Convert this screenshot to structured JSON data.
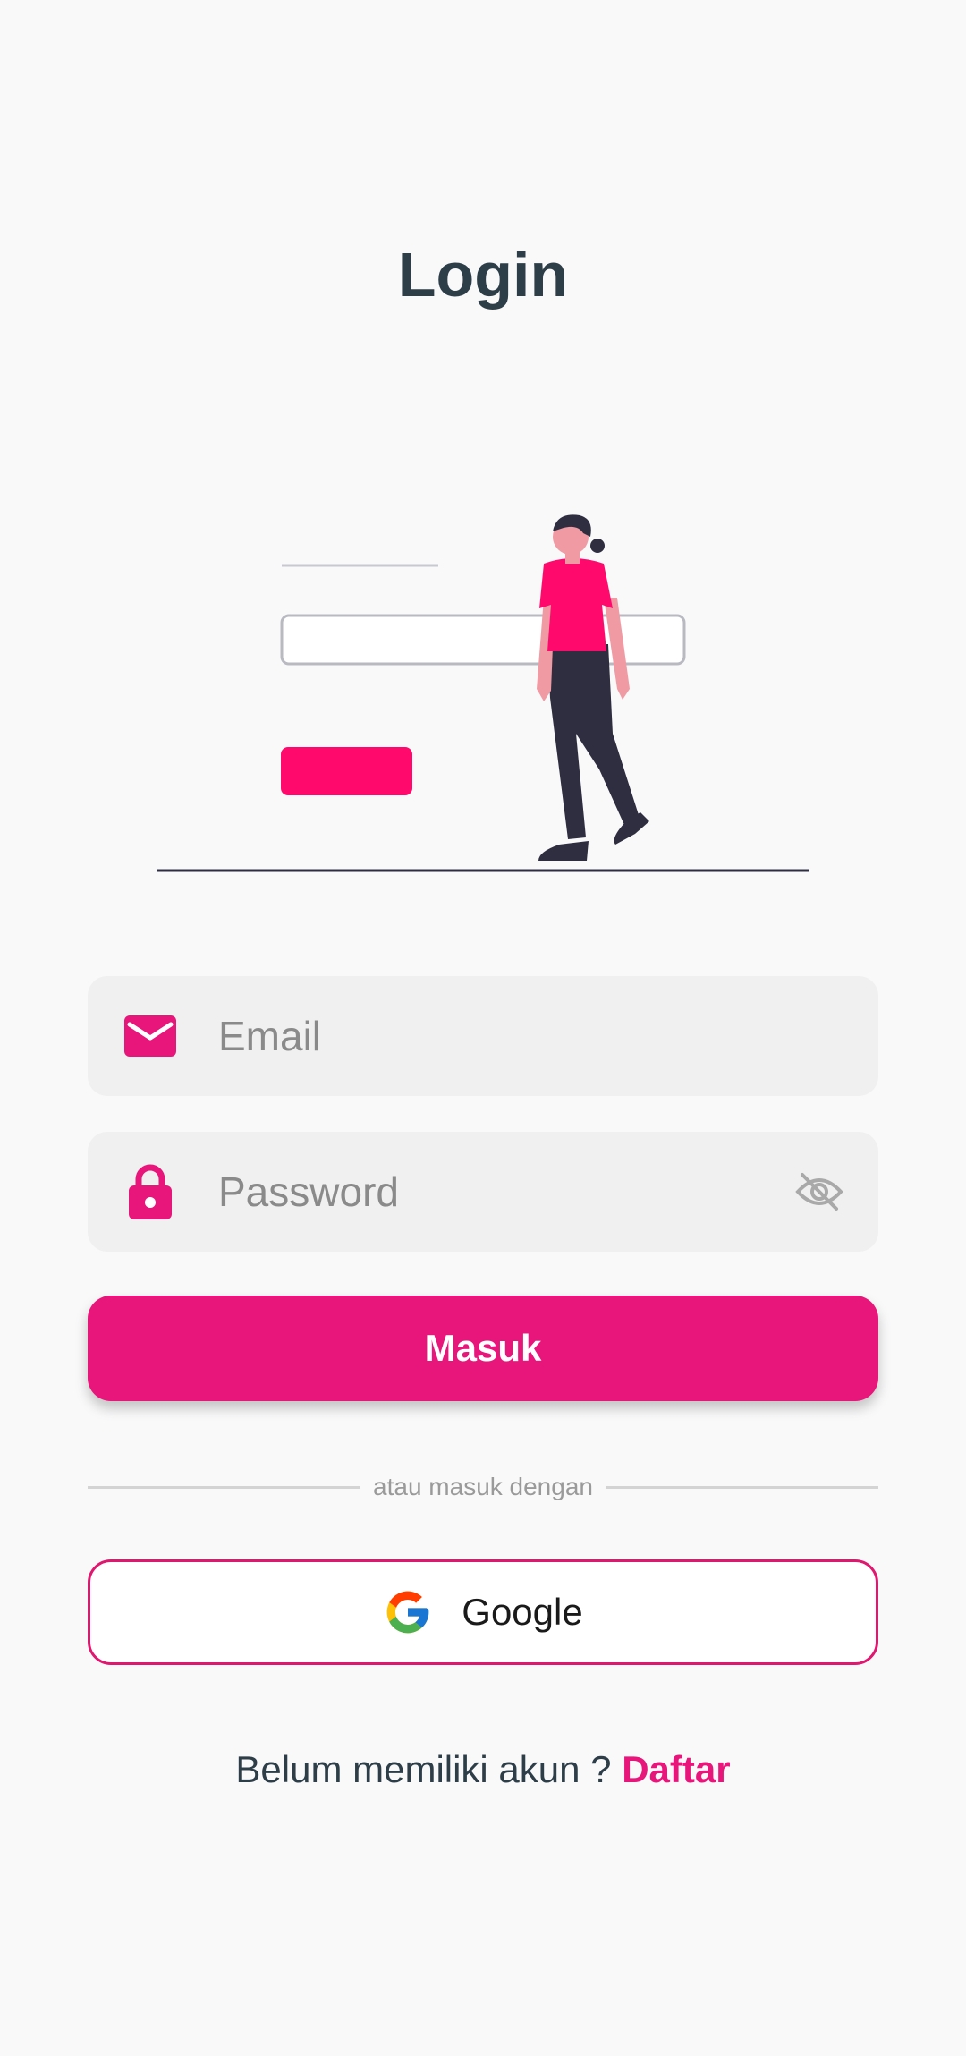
{
  "title": "Login",
  "colors": {
    "accent": "#e8157a",
    "title_text": "#2e3e48",
    "field_bg": "#f0f0f1"
  },
  "illustration": {
    "icon": "person-standing-by-login-form-illustration"
  },
  "email_field": {
    "icon": "envelope-icon",
    "placeholder": "Email",
    "value": ""
  },
  "password_field": {
    "icon": "lock-icon",
    "placeholder": "Password",
    "value": "",
    "toggle_icon": "eye-off-icon"
  },
  "login_button": {
    "label": "Masuk"
  },
  "divider": {
    "label": "atau masuk dengan"
  },
  "google_button": {
    "icon": "google-icon",
    "label": "Google"
  },
  "signup": {
    "prompt": "Belum memiliki akun ?",
    "link_label": "Daftar"
  }
}
